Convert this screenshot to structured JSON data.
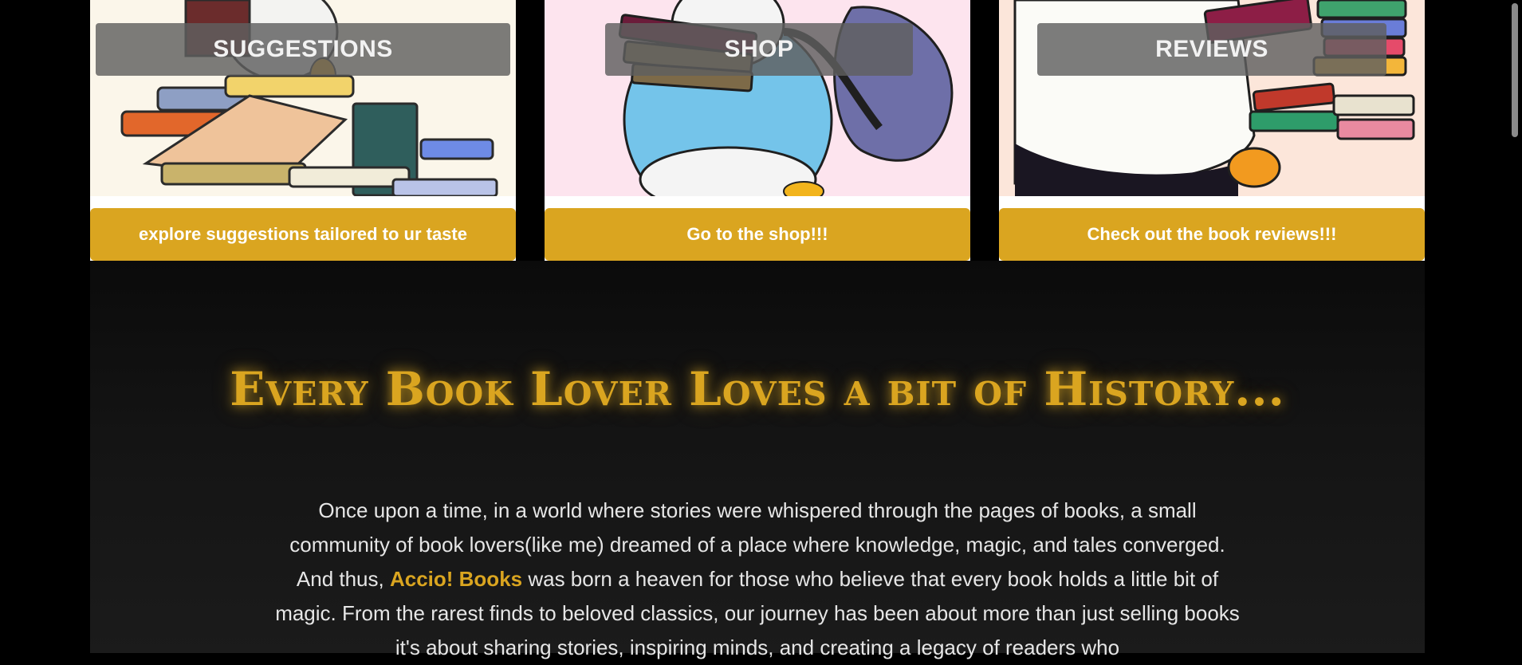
{
  "cards": [
    {
      "title": "SUGGESTIONS",
      "cta": "explore suggestions tailored to ur taste",
      "art_bg": "#FBF6EA",
      "art_icon": "penguin-reading-books-illustration"
    },
    {
      "title": "SHOP",
      "cta": "Go to the shop!!!",
      "art_bg": "#FDE4EE",
      "art_icon": "penguin-with-backpack-and-books-illustration"
    },
    {
      "title": "REVIEWS",
      "cta": "Check out the book reviews!!!",
      "art_bg": "#FCE6DA",
      "art_icon": "penguin-with-book-stack-illustration"
    }
  ],
  "history": {
    "heading": "Every Book Lover Loves a bit of History...",
    "body_before": "Once upon a time, in a world where stories were whispered through the pages of books, a small community of book lovers(like me) dreamed of a place where knowledge, magic, and tales converged. And thus, ",
    "brand": "Accio! Books",
    "body_after": " was born a heaven for those who believe that every book holds a little bit of magic. From the rarest finds to beloved classics, our journey has been about more than just selling books it's about sharing stories, inspiring minds, and creating a legacy of readers who"
  },
  "colors": {
    "accent": "#DAA520",
    "background": "#000000",
    "label_overlay": "#5F5F5F"
  }
}
